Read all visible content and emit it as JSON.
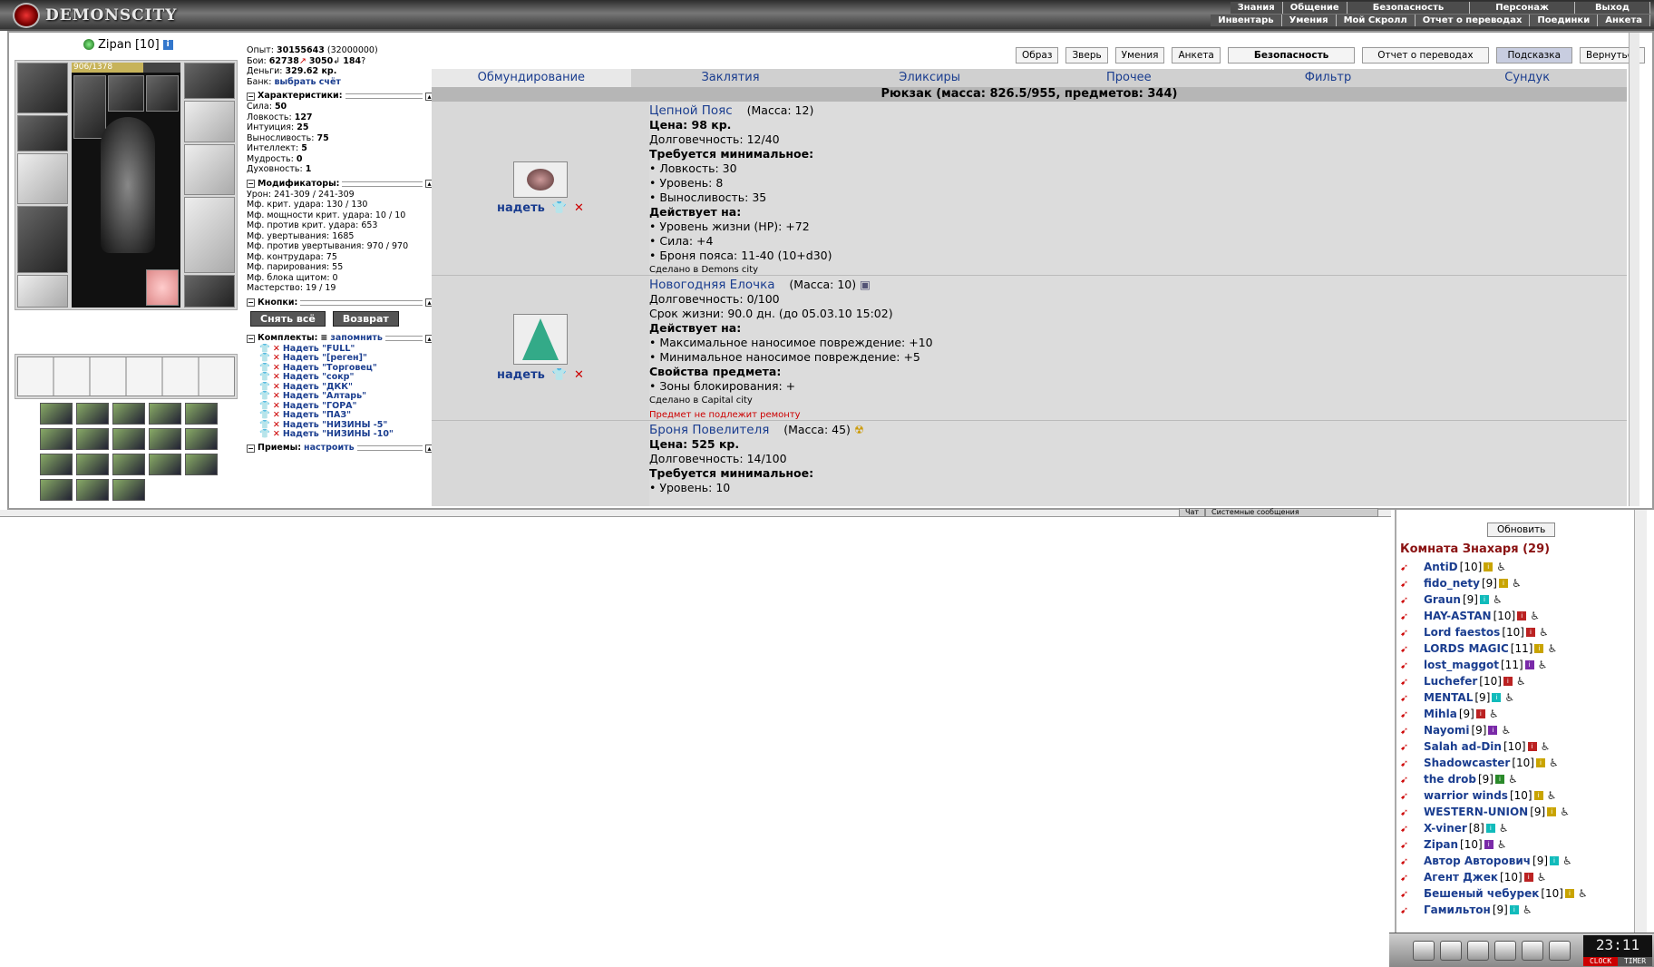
{
  "app": {
    "logo_text": "DEMONSCITY"
  },
  "top_menu": {
    "row1": [
      "Знания",
      "Общение",
      "Безопасность",
      "Персонаж",
      "Выход"
    ],
    "row2": [
      "Инвентарь",
      "Умения",
      "Мой Скролл",
      "Отчет о переводах",
      "Поединки",
      "Анкета"
    ]
  },
  "character": {
    "name": "Zipan",
    "level": "[10]",
    "hp_text": "906/1378",
    "hp_fraction": 0.657
  },
  "stats": {
    "exp_label": "Опыт:",
    "exp_value": "30155643",
    "exp_next": "(32000000)",
    "fights_label": "Бои:",
    "wins": "62738",
    "losses": "3050",
    "draws": "184",
    "money_label": "Деньги:",
    "money_value": "329.62 кр.",
    "bank_label": "Банк:",
    "bank_link": "выбрать счёт",
    "characteristics_header": "Характеристики:",
    "characteristics": [
      {
        "label": "Сила:",
        "value": "50"
      },
      {
        "label": "Ловкость:",
        "value": "127"
      },
      {
        "label": "Интуиция:",
        "value": "25"
      },
      {
        "label": "Выносливость:",
        "value": "75"
      },
      {
        "label": "Интеллект:",
        "value": "5"
      },
      {
        "label": "Мудрость:",
        "value": "0"
      },
      {
        "label": "Духовность:",
        "value": "1"
      }
    ],
    "modifiers_header": "Модификаторы:",
    "modifiers": [
      "Урон: 241-309 / 241-309",
      "Мф. крит. удара: 130 / 130",
      "Мф. мощности крит. удара: 10 / 10",
      "Мф. против крит. удара: 653",
      "Мф. увертывания: 1685",
      "Мф. против увертывания: 970 / 970",
      "Мф. контрудара: 75",
      "Мф. парирования: 55",
      "Мф. блока щитом: 0",
      "Мастерство: 19 / 19"
    ],
    "buttons_header": "Кнопки:",
    "btn_remove_all": "Снять всё",
    "btn_return": "Возврат",
    "sets_header": "Комплекты:",
    "sets_remember": "запомнить",
    "sets": [
      "Надеть \"FULL\"",
      "Надеть \"[реген]\"",
      "Надеть \"Торговец\"",
      "Надеть \"сокр\"",
      "Надеть \"ДКК\"",
      "Надеть \"Алтарь\"",
      "Надеть \"ГОРА\"",
      "Надеть \"ПАЗ\"",
      "Надеть \"НИЗИНЫ -5\"",
      "Надеть \"НИЗИНЫ -10\""
    ],
    "techniques_header": "Приемы:",
    "techniques_link": "настроить"
  },
  "top_buttons": [
    "Образ",
    "Зверь",
    "Умения",
    "Анкета",
    "Безопасность",
    "Отчет о переводах",
    "Подсказка",
    "Вернуться"
  ],
  "tabs": [
    "Обмундирование",
    "Заклятия",
    "Эликсиры",
    "Прочее",
    "Фильтр",
    "Сундук"
  ],
  "inventory_header": "Рюкзак (масса: 826.5/955, предметов: 344)",
  "items": [
    {
      "name": "Цепной Пояс",
      "mass": "(Масса: 12)",
      "action": "надеть",
      "lines": [
        {
          "text": "Цена: 98 кр.",
          "bold": true
        },
        {
          "text": "Долговечность: 12/40",
          "bold": false
        },
        {
          "text": "Требуется минимальное:",
          "bold": true
        },
        {
          "text": "• Ловкость: 30",
          "bold": false
        },
        {
          "text": "• Уровень: 8",
          "bold": false
        },
        {
          "text": "• Выносливость: 35",
          "bold": false
        },
        {
          "text": "Действует на:",
          "bold": true
        },
        {
          "text": "• Уровень жизни (HP): +72",
          "bold": false
        },
        {
          "text": "• Сила: +4",
          "bold": false
        },
        {
          "text": "• Броня пояса: 11-40 (10+d30)",
          "bold": false
        }
      ],
      "made": "Сделано в Demons city",
      "note": ""
    },
    {
      "name": "Новогодняя Елочка",
      "mass": "(Масса: 10)",
      "action": "надеть",
      "lines": [
        {
          "text": "Долговечность: 0/100",
          "bold": false
        },
        {
          "text": "Срок жизни: 90.0 дн. (до 05.03.10 15:02)",
          "bold": false
        },
        {
          "text": "Действует на:",
          "bold": true
        },
        {
          "text": "• Максимальное наносимое повреждение: +10",
          "bold": false
        },
        {
          "text": "• Минимальное наносимое повреждение: +5",
          "bold": false
        },
        {
          "text": "Свойства предмета:",
          "bold": true
        },
        {
          "text": "• Зоны блокирования: +",
          "bold": false
        }
      ],
      "made": "Сделано в Capital city",
      "note": "Предмет не подлежит ремонту"
    },
    {
      "name": "Броня Повелителя",
      "mass": "(Масса: 45)",
      "action": "",
      "lines": [
        {
          "text": "Цена: 525 кр.",
          "bold": true
        },
        {
          "text": "Долговечность: 14/100",
          "bold": false
        },
        {
          "text": "Требуется минимальное:",
          "bold": true
        },
        {
          "text": "• Уровень: 10",
          "bold": false
        }
      ],
      "made": "",
      "note": ""
    }
  ],
  "chat_tabs": [
    "Чат",
    "Системные сообщения"
  ],
  "room": {
    "refresh": "Обновить",
    "title": "Комната Знахаря (29)",
    "users": [
      {
        "name": "AntiD",
        "level": "[10]",
        "color": "#c9a400"
      },
      {
        "name": "fido_nety",
        "level": "[9]",
        "color": "#c9a400"
      },
      {
        "name": "Graun",
        "level": "[9]",
        "color": "#1bb"
      },
      {
        "name": "HAY-ASTAN",
        "level": "[10]",
        "color": "#b22"
      },
      {
        "name": "Lord faestos",
        "level": "[10]",
        "color": "#b22"
      },
      {
        "name": "LORDS MAGIC",
        "level": "[11]",
        "color": "#c9a400"
      },
      {
        "name": "lost_maggot",
        "level": "[11]",
        "color": "#7a2aa8"
      },
      {
        "name": "Luchefer",
        "level": "[10]",
        "color": "#b22"
      },
      {
        "name": "MENTAL",
        "level": "[9]",
        "color": "#1bb"
      },
      {
        "name": "Mihla",
        "level": "[9]",
        "color": "#b22"
      },
      {
        "name": "Nayomi",
        "level": "[9]",
        "color": "#7a2aa8"
      },
      {
        "name": "Salah ad-Din",
        "level": "[10]",
        "color": "#b22"
      },
      {
        "name": "Shadowcaster",
        "level": "[10]",
        "color": "#c9a400"
      },
      {
        "name": "the drob",
        "level": "[9]",
        "color": "#2a8a2a"
      },
      {
        "name": "warrior winds",
        "level": "[10]",
        "color": "#c9a400"
      },
      {
        "name": "WESTERN-UNION",
        "level": "[9]",
        "color": "#c9a400"
      },
      {
        "name": "X-viner",
        "level": "[8]",
        "color": "#1bb"
      },
      {
        "name": "Zipan",
        "level": "[10]",
        "color": "#7a2aa8"
      },
      {
        "name": "Автор Авторович",
        "level": "[9]",
        "color": "#1bb"
      },
      {
        "name": "Агент Джек",
        "level": "[10]",
        "color": "#b22"
      },
      {
        "name": "Бешеный чебурек",
        "level": "[10]",
        "color": "#c9a400"
      },
      {
        "name": "Гамильтон",
        "level": "[9]",
        "color": "#1bb"
      }
    ]
  },
  "clock": {
    "time": "23:11",
    "clock_label": "CLOCK",
    "timer_label": "TIMER"
  }
}
